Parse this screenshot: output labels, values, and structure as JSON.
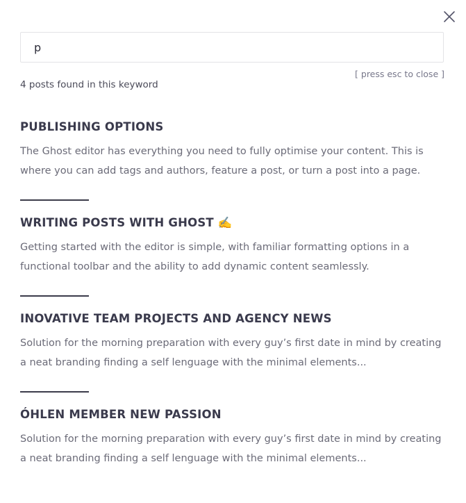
{
  "search": {
    "value": "p",
    "esc_hint": "[ press esc to close ]",
    "results_count": "4 posts found in this keyword"
  },
  "icons": {
    "close": "close-icon"
  },
  "colors": {
    "title": "#3a3a4c",
    "excerpt": "#6b6b78",
    "divider": "#3b3b4a",
    "input_border": "#e3e3e6"
  },
  "results": [
    {
      "title": "PUBLISHING OPTIONS",
      "excerpt": "The Ghost editor has everything you need to fully optimise your content. This is where you can add tags and authors, feature a post, or turn a post into a page."
    },
    {
      "title": "WRITING POSTS WITH GHOST ✍️",
      "excerpt": "Getting started with the editor is simple, with familiar formatting options in a functional toolbar and the ability to add dynamic content seamlessly."
    },
    {
      "title": "INOVATIVE TEAM PROJECTS AND AGENCY NEWS",
      "excerpt": "Solution for the morning preparation with every guy’s first date in mind by creating a neat branding finding a self lenguage with the minimal elements..."
    },
    {
      "title": "ÓHLEN MEMBER NEW PASSION",
      "excerpt": "Solution for the morning preparation with every guy’s first date in mind by creating a neat branding finding a self lenguage with the minimal elements..."
    }
  ]
}
